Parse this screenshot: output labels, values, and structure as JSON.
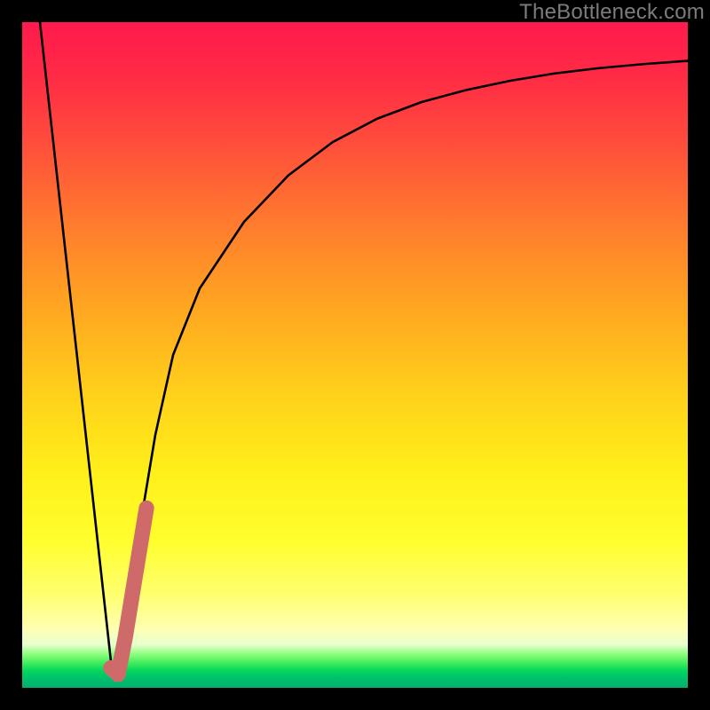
{
  "watermark": {
    "text": "TheBottleneck.com"
  },
  "colors": {
    "curve_stroke": "#000000",
    "highlight_stroke": "#cf6a6a",
    "frame": "#000000"
  },
  "chart_data": {
    "type": "line",
    "title": "",
    "xlabel": "",
    "ylabel": "",
    "xlim": [
      0,
      100
    ],
    "ylim": [
      0,
      100
    ],
    "series": [
      {
        "name": "bottleneck-curve",
        "x": [
          2.67,
          4,
          6,
          8,
          10,
          12,
          13.33,
          14.67,
          16,
          18,
          20,
          22.67,
          26.67,
          33.33,
          40,
          46.67,
          53.33,
          60,
          66.67,
          73.33,
          80,
          86.67,
          93.33,
          100
        ],
        "y": [
          100,
          88,
          70,
          52,
          34,
          16,
          4,
          2,
          10,
          26,
          38,
          50,
          60,
          70,
          77,
          82,
          85.5,
          88,
          89.8,
          91.2,
          92.3,
          93.1,
          93.7,
          94.2
        ]
      },
      {
        "name": "highlight-segment",
        "x": [
          13.33,
          14.4,
          15.47,
          16.53,
          17.6,
          18.67
        ],
        "y": [
          3,
          2,
          7.5,
          14,
          20.5,
          27
        ]
      }
    ]
  }
}
